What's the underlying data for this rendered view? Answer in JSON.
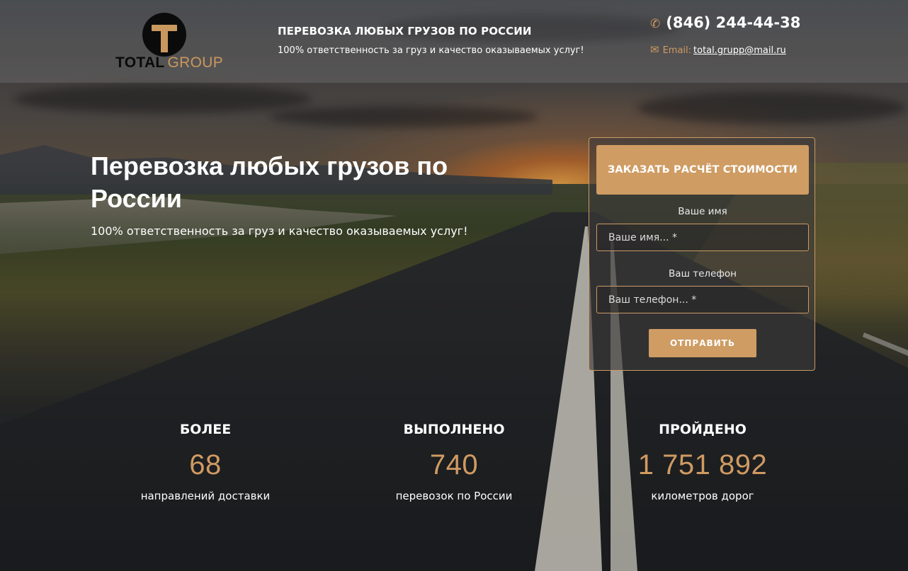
{
  "brand": {
    "logo_total": "TOTAL",
    "logo_group": "GROUP"
  },
  "header": {
    "title": "ПЕРЕВОЗКА ЛЮБЫХ ГРУЗОВ ПО РОССИИ",
    "subtitle": "100% ответственность за груз и качество оказываемых услуг!",
    "phone": "(846) 244-44-38",
    "phone_icon": "phone-icon",
    "email_label": "Email:",
    "email": "total.grupp@mail.ru",
    "email_icon": "envelope-icon"
  },
  "hero": {
    "title": "Перевозка любых грузов по России",
    "subtitle": "100% ответственность за груз и качество оказываемых услуг!"
  },
  "form": {
    "heading": "ЗАКАЗАТЬ РАСЧЁТ СТОИМОСТИ",
    "name_label": "Ваше имя",
    "name_placeholder": "Ваше имя... *",
    "phone_label": "Ваш телефон",
    "phone_placeholder": "Ваш телефон... *",
    "submit_label": "ОТПРАВИТЬ"
  },
  "stats": [
    {
      "head": "БОЛЕЕ",
      "value": "68",
      "caption": "направлений доставки"
    },
    {
      "head": "ВЫПОЛНЕНО",
      "value": "740",
      "caption": "перевозок по России"
    },
    {
      "head": "ПРОЙДЕНО",
      "value": "1 751 892",
      "caption": "километров дорог"
    }
  ],
  "colors": {
    "accent": "#cf9c63",
    "logo_dark": "#0b0b0b"
  }
}
